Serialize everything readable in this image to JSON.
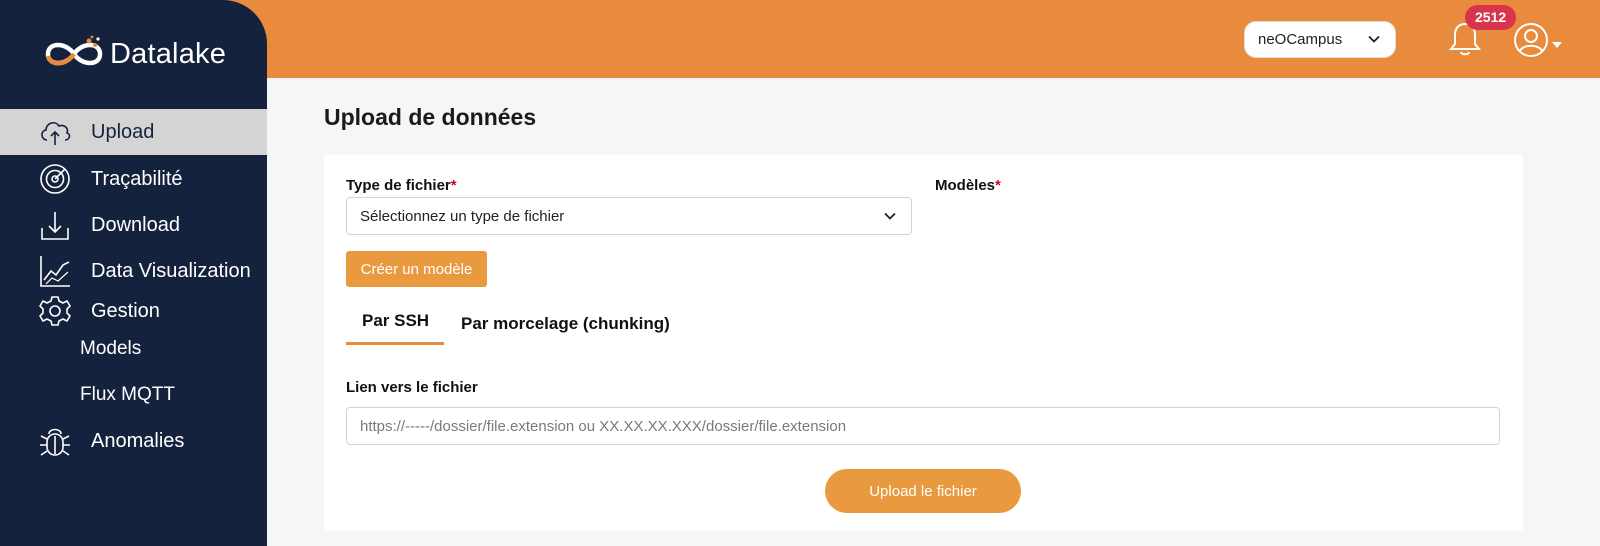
{
  "app": {
    "logo_text": "Datalake"
  },
  "sidebar": {
    "items": [
      {
        "label": "Upload",
        "icon": "cloud-upload-icon",
        "active": true
      },
      {
        "label": "Traçabilité",
        "icon": "radar-icon"
      },
      {
        "label": "Download",
        "icon": "download-icon"
      },
      {
        "label": "Data Visualization",
        "icon": "chart-line-icon"
      },
      {
        "label": "Gestion",
        "icon": "gear-icon"
      }
    ],
    "sub_items": [
      {
        "label": "Models"
      },
      {
        "label": "Flux MQTT"
      }
    ],
    "anomalies": {
      "label": "Anomalies",
      "icon": "bug-icon"
    }
  },
  "header": {
    "campus": "neOCampus",
    "notification_count": "2512",
    "icons": [
      "bell-icon",
      "user-icon",
      "caret-down-icon"
    ]
  },
  "main": {
    "title": "Upload de données",
    "file_type": {
      "label": "Type de fichier",
      "required_mark": "*",
      "selected": "Sélectionnez un type de fichier"
    },
    "models": {
      "label": "Modèles",
      "required_mark": "*"
    },
    "create_model_button": "Créer un modèle",
    "tabs": [
      {
        "label": "Par SSH",
        "active": true
      },
      {
        "label": "Par morcelage (chunking)"
      }
    ],
    "link": {
      "label": "Lien vers le fichier",
      "placeholder": "https://-----/dossier/file.extension ou XX.XX.XX.XXX/dossier/file.extension"
    },
    "upload_button": "Upload le fichier"
  },
  "colors": {
    "accent": "#e98b3c",
    "sidebar_bg": "#14223d",
    "badge": "#d8344b",
    "active_item_bg": "#d4d4d4"
  }
}
